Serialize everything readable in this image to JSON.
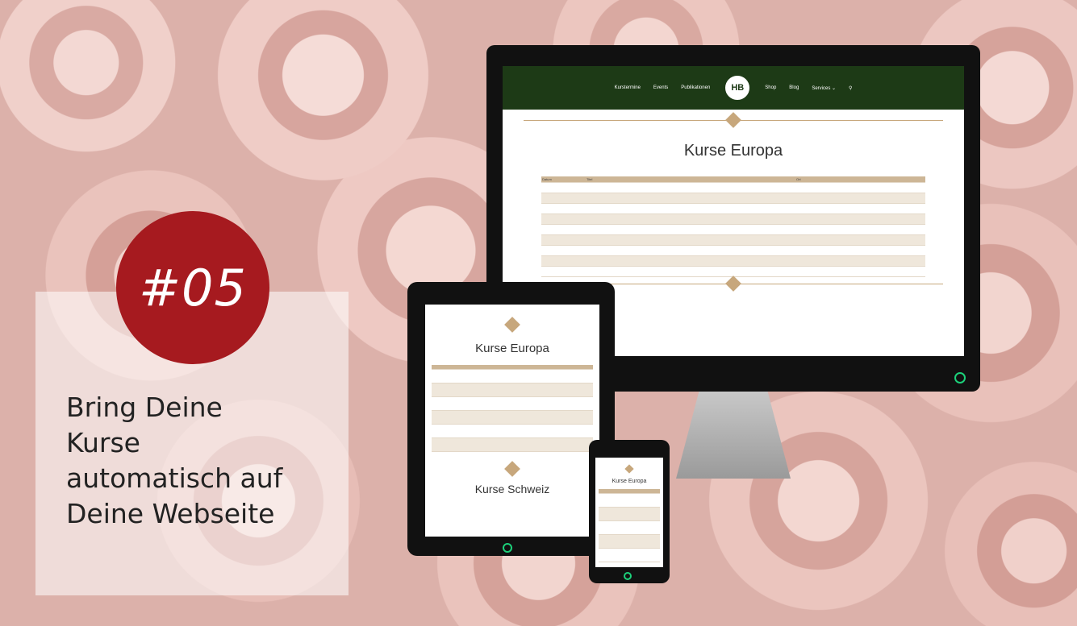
{
  "badge": {
    "text": "#05",
    "color": "#a61a1f"
  },
  "headline": {
    "lines": [
      "Bring Deine",
      "Kurse",
      "automatisch auf",
      "Deine Webseite"
    ]
  },
  "desktop": {
    "nav_items": [
      "Kurstermine",
      "Events",
      "Publikationen",
      "Shop",
      "Blog",
      "Services ⌄",
      "⚲"
    ],
    "logo_text": "HB",
    "section_title": "Kurse Europa",
    "table_header": [
      "Datum",
      "Titel",
      "Ort"
    ],
    "row_count": 9
  },
  "tablet": {
    "section_title": "Kurse Europa",
    "section_title_2": "Kurse Schweiz",
    "row_count": 6
  },
  "phone": {
    "section_title": "Kurse Europa",
    "row_count": 5
  },
  "colors": {
    "brand_green": "#1d3a16",
    "accent_tan": "#c7a77c",
    "power_led": "#1cd07a"
  }
}
